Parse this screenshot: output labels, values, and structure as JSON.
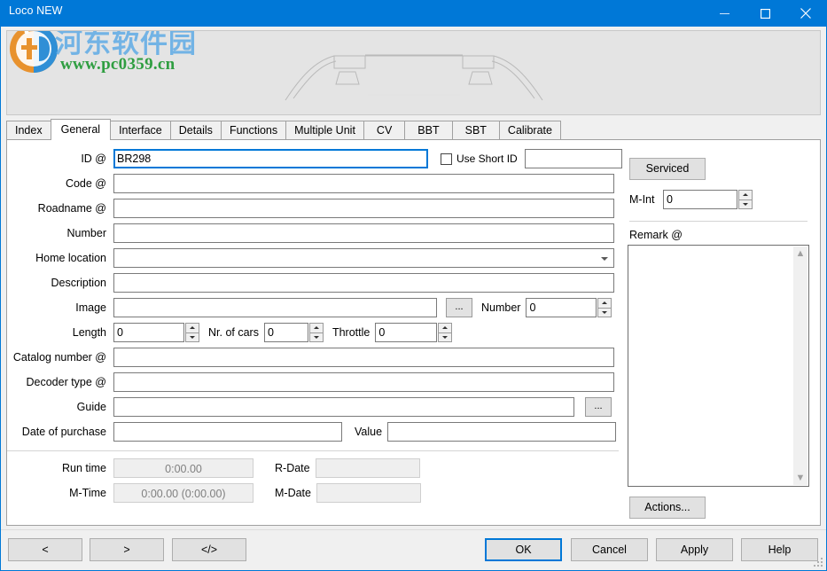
{
  "window": {
    "title": "Loco NEW",
    "minimize_label": "minimize",
    "maximize_label": "maximize",
    "close_label": "close"
  },
  "watermark": {
    "text_cn": "河东软件园",
    "url": "www.pc0359.cn"
  },
  "tabs": [
    {
      "label": "Index",
      "active": false
    },
    {
      "label": "General",
      "active": true
    },
    {
      "label": "Interface",
      "active": false
    },
    {
      "label": "Details",
      "active": false
    },
    {
      "label": "Functions",
      "active": false
    },
    {
      "label": "Multiple Unit",
      "active": false
    },
    {
      "label": "CV",
      "active": false
    },
    {
      "label": "BBT",
      "active": false
    },
    {
      "label": "SBT",
      "active": false
    },
    {
      "label": "Calibrate",
      "active": false
    }
  ],
  "general": {
    "id_label": "ID @",
    "id_value": "BR298",
    "use_short_id_label": "Use Short ID",
    "use_short_id_checked": false,
    "short_id_value": "",
    "code_label": "Code @",
    "code_value": "",
    "roadname_label": "Roadname @",
    "roadname_value": "",
    "number_label": "Number",
    "number_value": "",
    "home_location_label": "Home location",
    "home_location_value": "",
    "description_label": "Description",
    "description_value": "",
    "image_label": "Image",
    "image_value": "",
    "image_browse_label": "...",
    "image_number_label": "Number",
    "image_number_value": "0",
    "length_label": "Length",
    "length_value": "0",
    "nr_of_cars_label": "Nr. of cars",
    "nr_of_cars_value": "0",
    "throttle_label": "Throttle",
    "throttle_value": "0",
    "catalog_number_label": "Catalog number @",
    "catalog_number_value": "",
    "decoder_type_label": "Decoder type @",
    "decoder_type_value": "",
    "guide_label": "Guide",
    "guide_value": "",
    "guide_browse_label": "...",
    "date_of_purchase_label": "Date of purchase",
    "date_of_purchase_value": "",
    "value_label": "Value",
    "value_value": "",
    "run_time_label": "Run time",
    "run_time_value": "0:00.00",
    "r_date_label": "R-Date",
    "r_date_value": "",
    "m_time_label": "M-Time",
    "m_time_value": "0:00.00 (0:00.00)",
    "m_date_label": "M-Date",
    "m_date_value": ""
  },
  "right_panel": {
    "serviced_label": "Serviced",
    "m_int_label": "M-Int",
    "m_int_value": "0",
    "remark_label": "Remark @",
    "remark_value": "",
    "actions_label": "Actions..."
  },
  "footer": {
    "prev_label": "<",
    "next_label": ">",
    "xml_label": "</>",
    "ok_label": "OK",
    "cancel_label": "Cancel",
    "apply_label": "Apply",
    "help_label": "Help"
  },
  "colors": {
    "titlebar": "#0078d7",
    "accent": "#0078d7",
    "dialog_bg": "#f0f0f0",
    "page_bg": "#ffffff",
    "picture_bg": "#e4e4e4",
    "disabled_field": "#efefef",
    "watermark_blue": "#5aa9e6",
    "watermark_green": "#2f9e41"
  }
}
